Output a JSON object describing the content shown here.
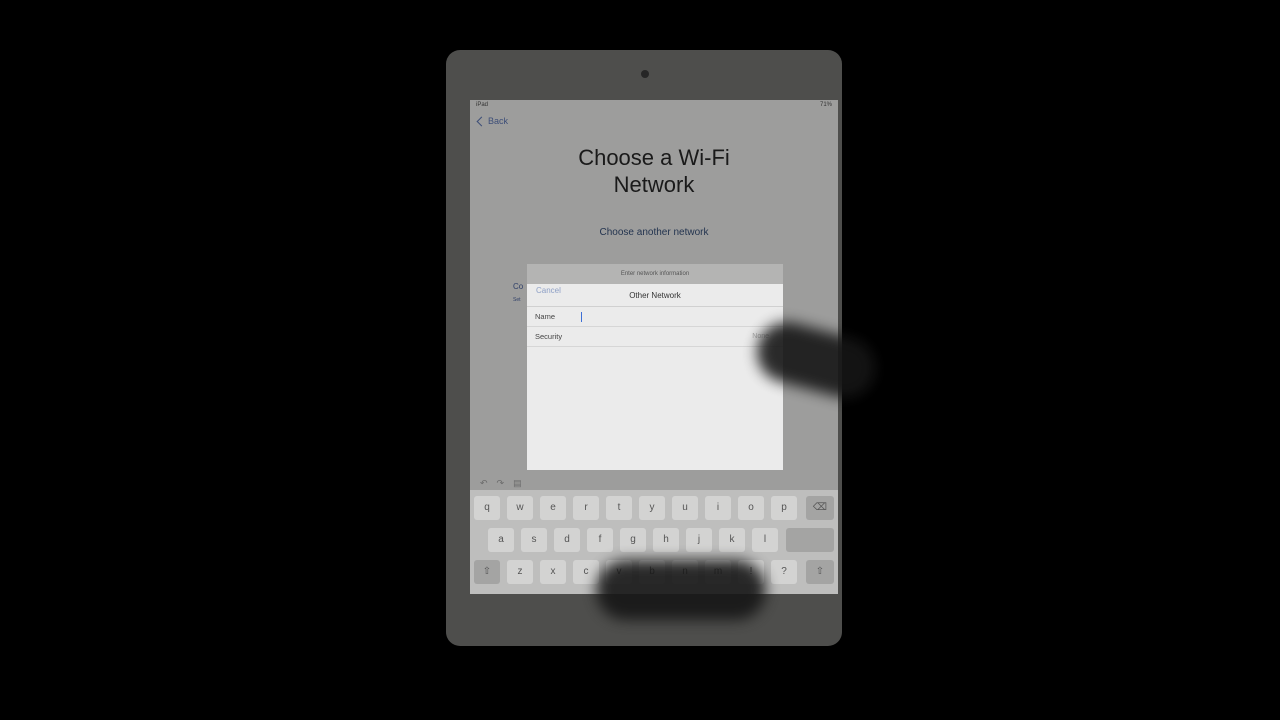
{
  "status": {
    "left": "iPad",
    "right": "71%"
  },
  "nav": {
    "back_label": "Back"
  },
  "title": {
    "line1": "Choose a Wi-Fi",
    "line2": "Network"
  },
  "choose_another_label": "Choose another network",
  "background_fragments": {
    "configure": "Co",
    "settings": "Set"
  },
  "modal": {
    "subtitle": "Enter network information",
    "title": "Other Network",
    "cancel_label": "Cancel",
    "name_label": "Name",
    "security_label": "Security",
    "security_value": "None"
  },
  "keyboard": {
    "row1": [
      "q",
      "w",
      "e",
      "r",
      "t",
      "y",
      "u",
      "i",
      "o",
      "p"
    ],
    "row2": [
      "a",
      "s",
      "d",
      "f",
      "g",
      "h",
      "j",
      "k",
      "l"
    ],
    "row3": [
      "z",
      "x",
      "c",
      "v",
      "b",
      "n",
      "m",
      "!",
      "?"
    ]
  }
}
